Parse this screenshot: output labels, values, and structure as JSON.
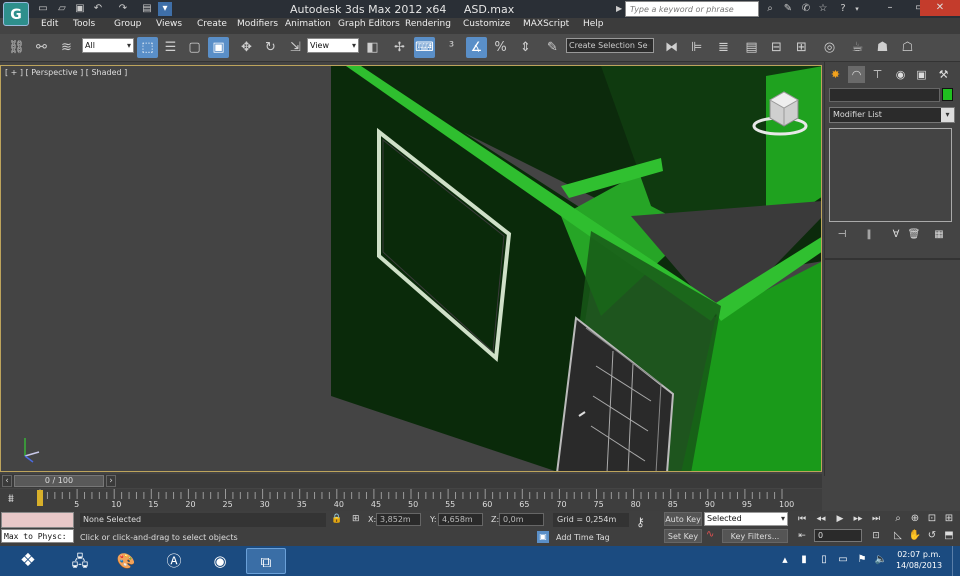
{
  "title_bar": {
    "app_title": "Autodesk 3ds Max  2012 x64",
    "file_name": "ASD.max",
    "search_placeholder": "Type a keyword or phrase"
  },
  "menu": [
    "Edit",
    "Tools",
    "Group",
    "Views",
    "Create",
    "Modifiers",
    "Animation",
    "Graph Editors",
    "Rendering",
    "Customize",
    "MAXScript",
    "Help"
  ],
  "toolbar": {
    "selection_filter": "All",
    "reference_coord": "View",
    "named_selection": "Create Selection Se"
  },
  "viewport": {
    "label": "[ + ] [ Perspective ] [ Shaded ]"
  },
  "command_panel": {
    "modifier_list": "Modifier List"
  },
  "timeline": {
    "frame_display": "0 / 100",
    "ticks": [
      "5",
      "10",
      "15",
      "20",
      "25",
      "30",
      "35",
      "40",
      "45",
      "50",
      "55",
      "60",
      "65",
      "70",
      "75",
      "80",
      "85",
      "90",
      "95",
      "100"
    ]
  },
  "status": {
    "maxscript_listener": "Max to Physc:",
    "selection": "None Selected",
    "prompt": "Click or click-and-drag to select objects",
    "x_label": "X:",
    "x_value": "3,852m",
    "y_label": "Y:",
    "y_value": "4,658m",
    "z_label": "Z:",
    "z_value": "0,0m",
    "grid": "Grid = 0,254m",
    "add_time_tag": "Add Time Tag"
  },
  "anim_controls": {
    "auto_key": "Auto Key",
    "set_key": "Set Key",
    "key_mode": "Selected",
    "key_filters": "Key Filters...",
    "current_frame": "0"
  },
  "taskbar": {
    "time": "02:07 p.m.",
    "date": "14/08/2013"
  },
  "colors": {
    "wall_green": "#2aa62a",
    "wall_dark": "#0c2a0c",
    "viewport_bg": "#444444",
    "active_blue": "#5a8fc8"
  }
}
